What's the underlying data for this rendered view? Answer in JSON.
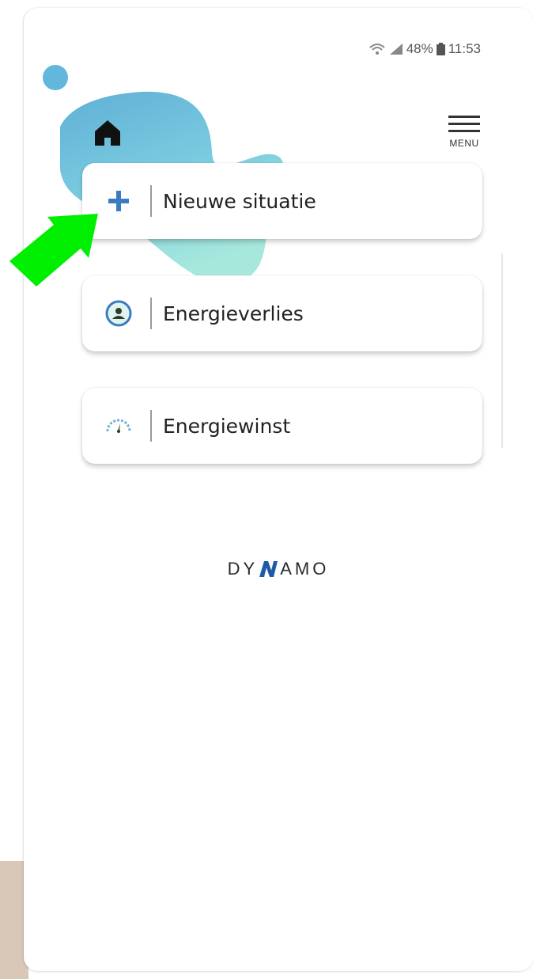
{
  "status_bar": {
    "battery": "48%",
    "time": "11:53"
  },
  "header": {
    "menu_label": "MENU"
  },
  "cards": [
    {
      "label": "Nieuwe situatie",
      "icon": "plus-icon"
    },
    {
      "label": "Energieverlies",
      "icon": "person-circle-icon"
    },
    {
      "label": "Energiewinst",
      "icon": "gauge-icon"
    }
  ],
  "logo": {
    "prefix": "DY",
    "suffix": "AMO"
  },
  "colors": {
    "accent_blue": "#3b7cc0",
    "blob_blue": "#5fb3d6",
    "blob_teal": "#9ee3dc",
    "arrow_green": "#00ee00",
    "logo_blue": "#1f5aa6"
  }
}
